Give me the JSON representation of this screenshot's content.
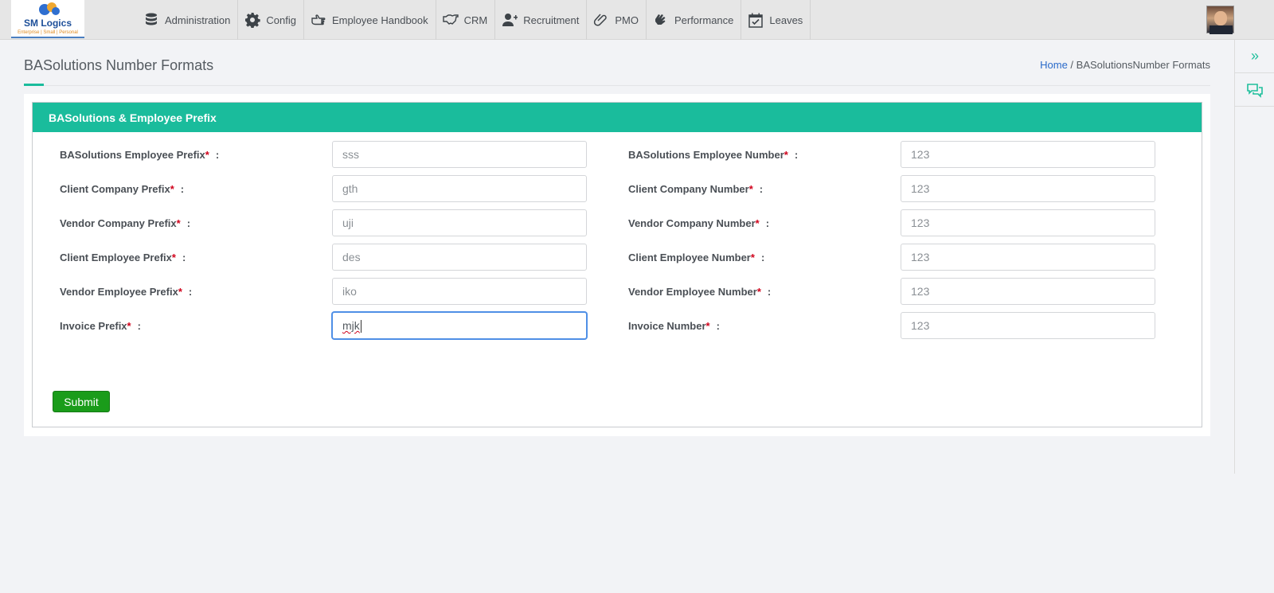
{
  "brand": {
    "name": "SM Logics",
    "tagline": "Enterprise | Small | Personal"
  },
  "nav": {
    "items": [
      {
        "label": "Administration",
        "icon": "database-icon"
      },
      {
        "label": "Config",
        "icon": "gear-icon"
      },
      {
        "label": "Employee Handbook",
        "icon": "hand-pointer-icon"
      },
      {
        "label": "CRM",
        "icon": "handshake-icon"
      },
      {
        "label": "Recruitment",
        "icon": "user-plus-icon"
      },
      {
        "label": "PMO",
        "icon": "paperclip-icon"
      },
      {
        "label": "Performance",
        "icon": "sign-language-icon"
      },
      {
        "label": "Leaves",
        "icon": "calendar-check-icon"
      }
    ]
  },
  "page": {
    "title": "BASolutions Number Formats",
    "breadcrumb": {
      "home": "Home",
      "separator": " / ",
      "current": "BASolutionsNumber Formats"
    }
  },
  "panel": {
    "heading": "BASolutions & Employee Prefix",
    "required_mark": "*",
    "colon": ":",
    "left_fields": [
      {
        "label": "BASolutions Employee Prefix",
        "value": "sss"
      },
      {
        "label": "Client Company Prefix",
        "value": "gth"
      },
      {
        "label": "Vendor Company Prefix",
        "value": "uji"
      },
      {
        "label": "Client Employee Prefix",
        "value": "des"
      },
      {
        "label": "Vendor Employee Prefix",
        "value": "iko"
      },
      {
        "label": "Invoice Prefix",
        "value": "mjk"
      }
    ],
    "right_fields": [
      {
        "label": "BASolutions Employee Number",
        "value": "123"
      },
      {
        "label": "Client Company Number",
        "value": "123"
      },
      {
        "label": "Vendor Company Number",
        "value": "123"
      },
      {
        "label": "Client Employee Number",
        "value": "123"
      },
      {
        "label": "Vendor Employee Number",
        "value": "123"
      },
      {
        "label": "Invoice Number",
        "value": "123"
      }
    ],
    "submit_label": "Submit"
  },
  "colors": {
    "accent": "#1abc9c",
    "submit": "#1a9c1a",
    "link": "#2a6ac9",
    "required": "#d0021b"
  }
}
